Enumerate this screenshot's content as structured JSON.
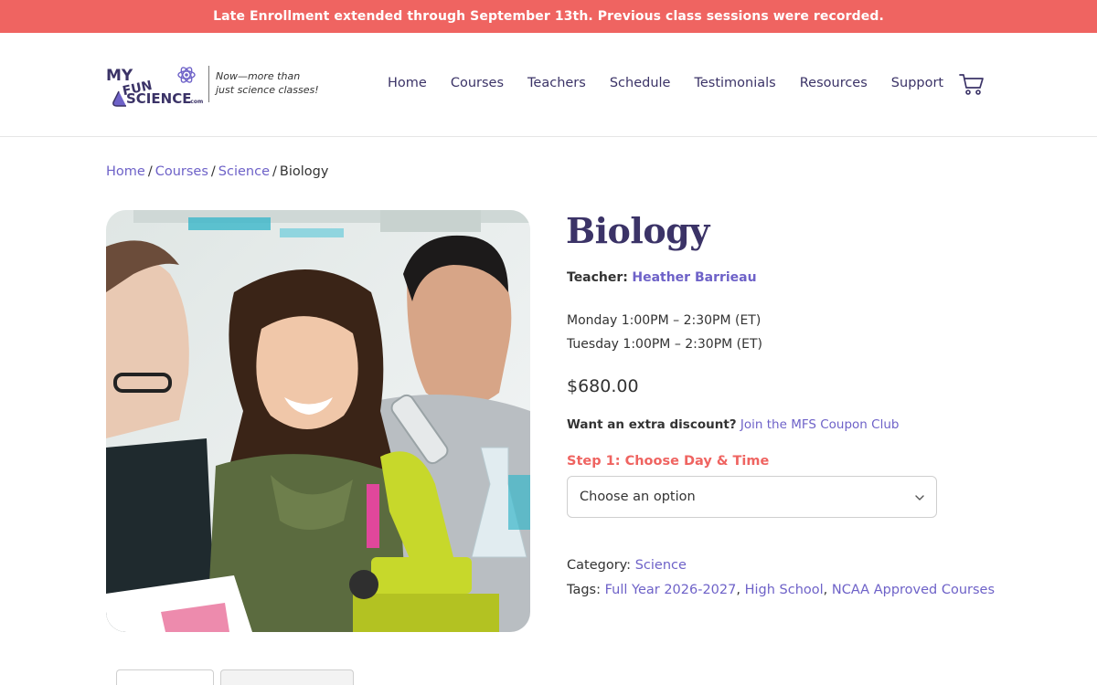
{
  "banner": {
    "text": "Late Enrollment extended through September 13th. Previous class sessions were recorded."
  },
  "header": {
    "logo_text": "MY FUN SCIENCE.com",
    "tagline_line1": "Now—more than",
    "tagline_line2": "just science classes!",
    "nav": [
      "Home",
      "Courses",
      "Teachers",
      "Schedule",
      "Testimonials",
      "Resources",
      "Support"
    ],
    "cart_icon": "cart-icon"
  },
  "breadcrumb": {
    "items": [
      "Home",
      "Courses",
      "Science"
    ],
    "current": "Biology",
    "separator": "/"
  },
  "product": {
    "title": "Biology",
    "teacher_label": "Teacher:",
    "teacher_name": "Heather Barrieau",
    "times": [
      "Monday 1:00PM – 2:30PM (ET)",
      "Tuesday 1:00PM – 2:30PM (ET)"
    ],
    "price": "$680.00",
    "discount_label": "Want an extra discount?",
    "discount_link": "Join the MFS Coupon Club",
    "step_label": "Step 1: Choose Day & Time",
    "select_value": "Choose an option",
    "category_label": "Category:",
    "category_value": "Science",
    "tags_label": "Tags:",
    "tags": [
      "Full Year 2026-2027",
      "High School",
      "NCAA Approved Courses"
    ]
  },
  "colors": {
    "banner": "#ef6461",
    "brand_purple": "#3b3367",
    "link": "#6e62c8",
    "accent_lime": "#c7d82b"
  }
}
